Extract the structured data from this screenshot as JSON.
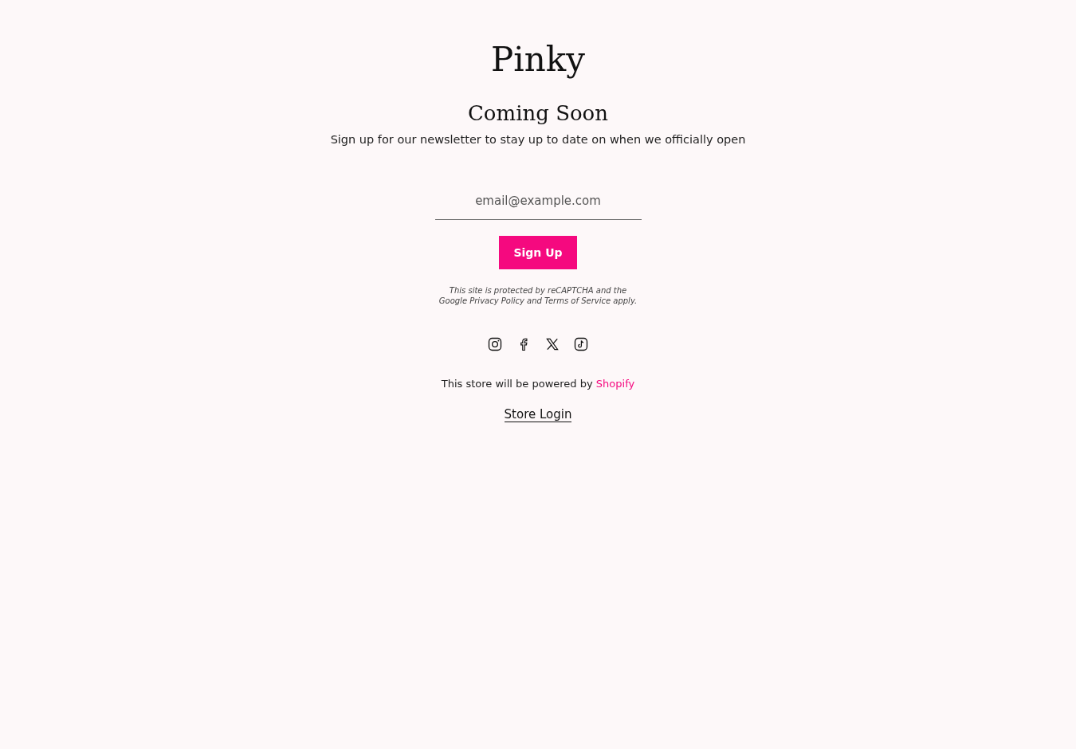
{
  "logo": "Pinky",
  "heading": "Coming Soon",
  "subheading": "Sign up for our newsletter to stay up to date on when we officially open",
  "email_field": {
    "placeholder": "email@example.com"
  },
  "signup_button": "Sign Up",
  "recaptcha_notice": "This site is protected by reCAPTCHA and the Google Privacy Policy and Terms of Service apply.",
  "social": [
    {
      "kind": "instagram"
    },
    {
      "kind": "facebook"
    },
    {
      "kind": "x"
    },
    {
      "kind": "tiktok"
    }
  ],
  "powered_by": {
    "text": "This store will be powered by",
    "link": "Shopify"
  },
  "store_login": "Store Login"
}
